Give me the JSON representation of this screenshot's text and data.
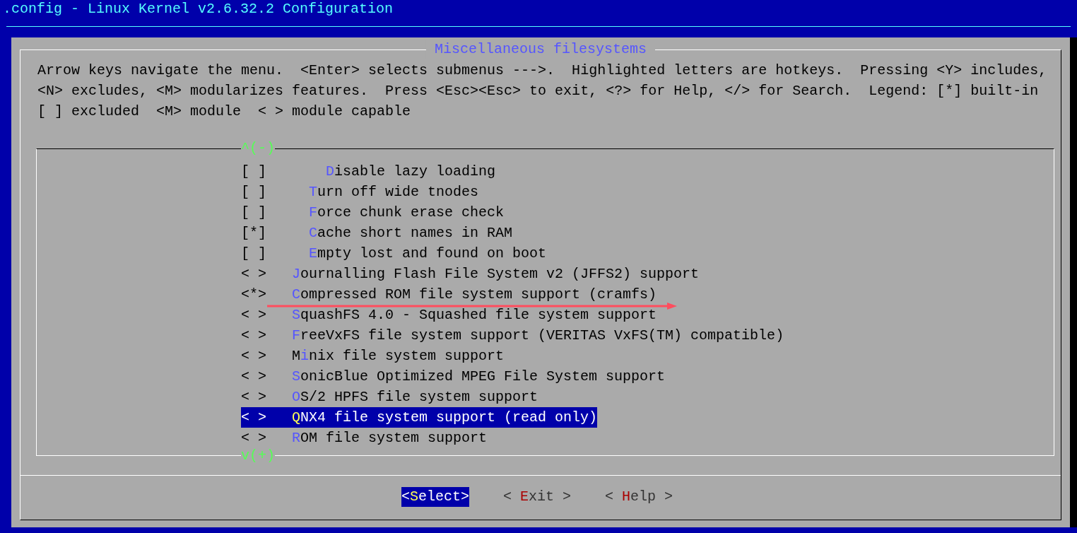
{
  "window": {
    "title": ".config - Linux Kernel v2.6.32.2 Configuration"
  },
  "dialog": {
    "title": "Miscellaneous filesystems",
    "help_lines": [
      "Arrow keys navigate the menu.  <Enter> selects submenus --->.  Highlighted letters are hotkeys.  Pressing <Y> includes,",
      "<N> excludes, <M> modularizes features.  Press <Esc><Esc> to exit, <?> for Help, </> for Search.  Legend: [*] built-in",
      "[ ] excluded  <M> module  < > module capable"
    ]
  },
  "menu": {
    "scroll_up": "^(-)",
    "scroll_down": "v(+)",
    "items": [
      {
        "children": [
          {
            "children": [
              {
                "prefix": "[ ]",
                "hotkey": "D",
                "after": "isable lazy loading",
                "selected": false
              }
            ]
          },
          {
            "prefix": "[ ]",
            "hotkey": "T",
            "after": "urn off wide tnodes",
            "selected": false
          },
          {
            "prefix": "[ ]",
            "hotkey": "F",
            "after": "orce chunk erase check",
            "selected": false
          },
          {
            "prefix": "[*]",
            "hotkey": "C",
            "after": "ache short names in RAM",
            "selected": false
          },
          {
            "prefix": "[ ]",
            "hotkey": "E",
            "after": "mpty lost and found on boot",
            "selected": false
          }
        ]
      },
      {
        "prefix": "< >",
        "hotkey": "J",
        "after": "ournalling Flash File System v2 (JFFS2) support",
        "selected": false
      },
      {
        "prefix": "<*>",
        "hotkey": "C",
        "after": "ompressed ROM file system support (cramfs)",
        "selected": false
      },
      {
        "prefix": "< >",
        "hotkey": "S",
        "after": "quashFS 4.0 - Squashed file system support",
        "selected": false
      },
      {
        "prefix": "< >",
        "hotkey": "F",
        "after": "reeVxFS file system support (VERITAS VxFS(TM) compatible)",
        "selected": false
      },
      {
        "prefix": "< >",
        "before": "M",
        "hotkey": "i",
        "after": "nix file system support",
        "selected": false
      },
      {
        "prefix": "< >",
        "hotkey": "S",
        "after": "onicBlue Optimized MPEG File System support",
        "selected": false
      },
      {
        "prefix": "< >",
        "hotkey": "O",
        "after": "S/2 HPFS file system support",
        "selected": false
      },
      {
        "prefix": "< >",
        "hotkey": "Q",
        "after": "NX4 file system support (read only)",
        "selected": true
      },
      {
        "prefix": "< >",
        "hotkey": "R",
        "after": "OM file system support",
        "selected": false
      }
    ]
  },
  "buttons": [
    {
      "before": "<",
      "hotkey": "S",
      "after": "elect>",
      "selected": true
    },
    {
      "before": "< ",
      "hotkey": "E",
      "after": "xit >",
      "selected": false
    },
    {
      "before": "< ",
      "hotkey": "H",
      "after": "elp >",
      "selected": false
    }
  ]
}
